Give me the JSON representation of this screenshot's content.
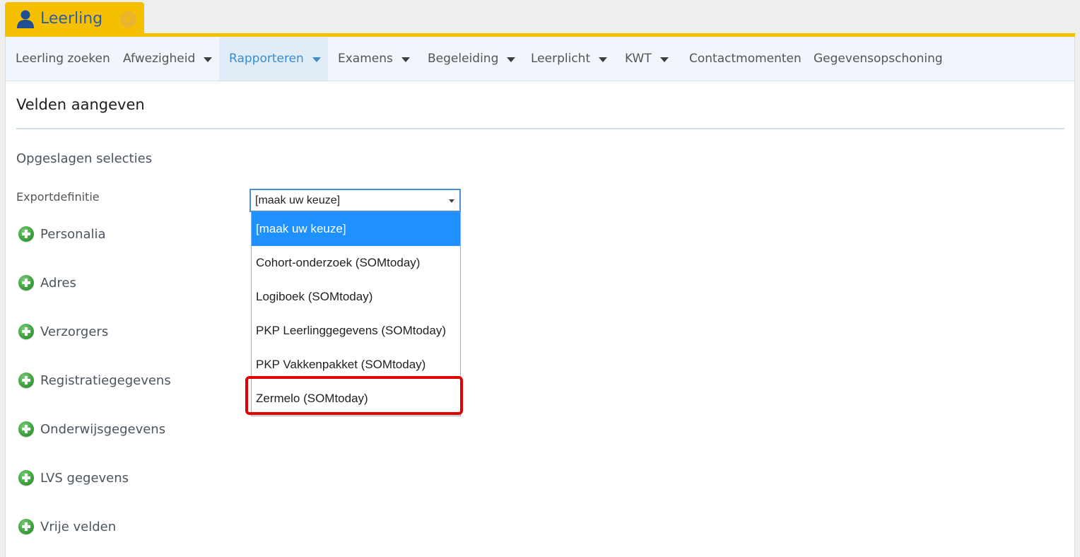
{
  "tab": {
    "label": "Leerling"
  },
  "navbar": {
    "items": [
      {
        "label": "Leerling zoeken",
        "has_caret": false,
        "active": false
      },
      {
        "label": "Afwezigheid",
        "has_caret": true,
        "active": false
      },
      {
        "label": "Rapporteren",
        "has_caret": true,
        "active": true
      },
      {
        "label": "Examens",
        "has_caret": true,
        "active": false
      },
      {
        "label": "Begeleiding",
        "has_caret": true,
        "active": false
      },
      {
        "label": "Leerplicht",
        "has_caret": true,
        "active": false
      },
      {
        "label": "KWT",
        "has_caret": true,
        "active": false
      },
      {
        "label": "Contactmomenten",
        "has_caret": false,
        "active": false
      },
      {
        "label": "Gegevensopschoning",
        "has_caret": false,
        "active": false
      }
    ]
  },
  "page": {
    "title": "Velden aangeven",
    "section_heading": "Opgeslagen selecties",
    "field_label": "Exportdefinitie"
  },
  "select": {
    "value": "[maak uw keuze]",
    "options": [
      "[maak uw keuze]",
      "Cohort-onderzoek (SOMtoday)",
      "Logiboek (SOMtoday)",
      "PKP Leerlinggegevens (SOMtoday)",
      "PKP Vakkenpakket (SOMtoday)",
      "Zermelo (SOMtoday)"
    ],
    "selected_index": 0,
    "highlighted_index": 5
  },
  "categories": [
    "Personalia",
    "Adres",
    "Verzorgers",
    "Registratiegegevens",
    "Onderwijsgegevens",
    "LVS gegevens",
    "Vrije velden"
  ],
  "colors": {
    "tab_yellow": "#f5c000",
    "accent_blue": "#3a8bd0",
    "selected_option": "#1e90ff",
    "highlight_red": "#e00000",
    "plus_green": "#3ea43e"
  }
}
